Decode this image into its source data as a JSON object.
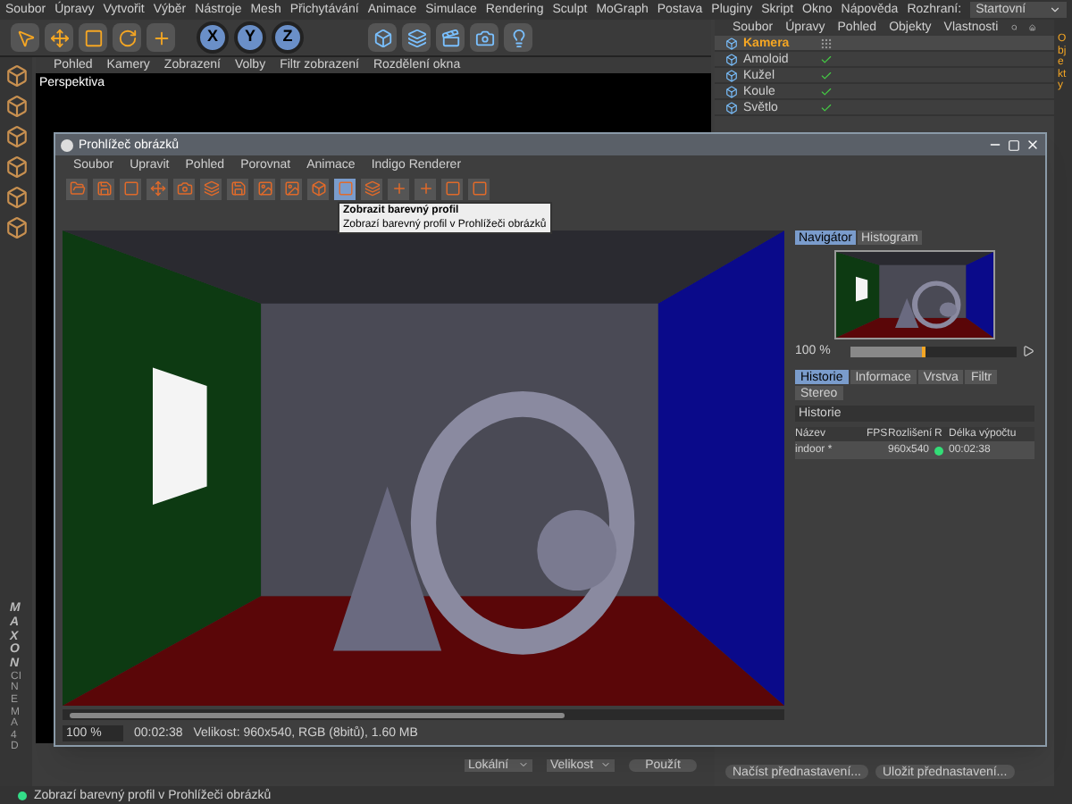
{
  "menu_bar": {
    "items": [
      "Soubor",
      "Úpravy",
      "Vytvořit",
      "Výběr",
      "Nástroje",
      "Mesh",
      "Přichytávání",
      "Animace",
      "Simulace",
      "Rendering",
      "Sculpt",
      "MoGraph",
      "Postava",
      "Pluginy",
      "Skript",
      "Okno",
      "Nápověda"
    ],
    "layout_label": "Rozhraní:",
    "layout_value": "Startovní"
  },
  "toolbar": {
    "axes": [
      "X",
      "Y",
      "Z"
    ]
  },
  "viewport": {
    "menu": [
      "Pohled",
      "Kamery",
      "Zobrazení",
      "Volby",
      "Filtr zobrazení",
      "Rozdělení okna"
    ],
    "label": "Perspektiva"
  },
  "object_manager": {
    "menu": [
      "Soubor",
      "Úpravy",
      "Pohled",
      "Objekty",
      "Vlastnosti"
    ],
    "objects": [
      {
        "name": "Kamera",
        "selected": true,
        "enabled": false
      },
      {
        "name": "Amoloid",
        "selected": false,
        "enabled": true
      },
      {
        "name": "Kužel",
        "selected": false,
        "enabled": true
      },
      {
        "name": "Koule",
        "selected": false,
        "enabled": true
      },
      {
        "name": "Světlo",
        "selected": false,
        "enabled": true
      }
    ]
  },
  "side_tabs": [
    "Objekty"
  ],
  "picture_viewer": {
    "title": "Prohlížeč obrázků",
    "menu": [
      "Soubor",
      "Upravit",
      "Pohled",
      "Porovnat",
      "Animace",
      "Indigo Renderer"
    ],
    "tooltip": {
      "title": "Zobrazit barevný profil",
      "text": "Zobrazí barevný profil v Prohlížeči obrázků"
    },
    "nav_tabs": [
      {
        "label": "Navigátor",
        "selected": true
      },
      {
        "label": "Histogram",
        "selected": false
      }
    ],
    "zoom": "100 %",
    "zoom_slider": {
      "level": 0.45
    },
    "panel_tabs": [
      {
        "label": "Historie",
        "selected": true
      },
      {
        "label": "Informace",
        "selected": false
      },
      {
        "label": "Vrstva",
        "selected": false
      },
      {
        "label": "Filtr",
        "selected": false
      },
      {
        "label": "Stereo",
        "selected": false
      }
    ],
    "history": {
      "title": "Historie",
      "columns": [
        "Název",
        "FPS",
        "Rozlišení",
        "R",
        "Délka výpočtu"
      ],
      "rows": [
        {
          "name": "indoor *",
          "resolution": "960x540",
          "color": "#33dd77",
          "time": "00:02:38"
        }
      ]
    },
    "status": {
      "zoom": "100 %",
      "time": "00:02:38",
      "info": "Velikost: 960x540, RGB (8bitů), 1.60 MB"
    }
  },
  "attributes": {
    "dropdowns": [
      "Lokální",
      "Velikost"
    ],
    "apply": "Použít",
    "presets": [
      "Načíst přednastavení...",
      "Uložit přednastavení..."
    ]
  },
  "logo": {
    "brand": "MAXON",
    "product": "CINEMA4D"
  },
  "status_bar": {
    "text": "Zobrazí barevný profil v Prohlížeči obrázků"
  }
}
